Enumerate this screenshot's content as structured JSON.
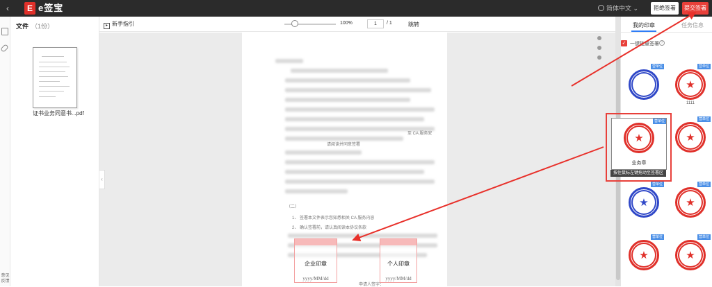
{
  "header": {
    "back_icon": "chevron-left-icon",
    "logo_mark": "E",
    "logo_text": "e签宝",
    "language": "简体中文",
    "reject_label": "拒绝签署",
    "submit_label": "提交签署"
  },
  "left_rail": {
    "bottom_label": "意见反馈"
  },
  "files": {
    "title": "文件",
    "count": "（1份）",
    "name": "证书业务同意书...pdf"
  },
  "toolbar": {
    "guide_label": "新手指引",
    "zoom": "100%",
    "page_current": "1",
    "page_total": "/ 1",
    "jump_label": "跳转"
  },
  "document": {
    "section_mark": "（二）",
    "ca_note_1": "至 CA 服务安",
    "ca_note_2": "请阅读并同意签署",
    "item_1": "1、 签署本文件表示您知悉相关 CA 服务内容",
    "item_2": "2、 确认签署前，请认真阅读本协议条款",
    "signer_label": "申请人签字："
  },
  "seal_fields": {
    "enterprise_label": "企业印章",
    "enterprise_date": "yyyy/MM/dd",
    "personal_label": "个人印章",
    "personal_date": "yyyy/MM/dd"
  },
  "right_panel": {
    "tab_my": "我的印章",
    "tab_task": "任务信息",
    "checkbox_label": "一键批量签署",
    "stamps": [
      {
        "tag": "营单位",
        "name": ""
      },
      {
        "tag": "营单位",
        "name": "1111"
      },
      {
        "tag": "营单位",
        "name": "业务章"
      },
      {
        "tag": "营单位",
        "name": ""
      },
      {
        "tag": "营单位",
        "name": ""
      },
      {
        "tag": "营单位",
        "name": ""
      },
      {
        "tag": "营单位",
        "name": ""
      },
      {
        "tag": "营单位",
        "name": ""
      }
    ],
    "hover_tip": "按住鼠标左键拖动至签署区"
  },
  "colors": {
    "accent_red": "#e8403a",
    "tag_blue": "#4a8fe7",
    "seal_red": "#e0302a",
    "seal_blue": "#3048c8"
  }
}
